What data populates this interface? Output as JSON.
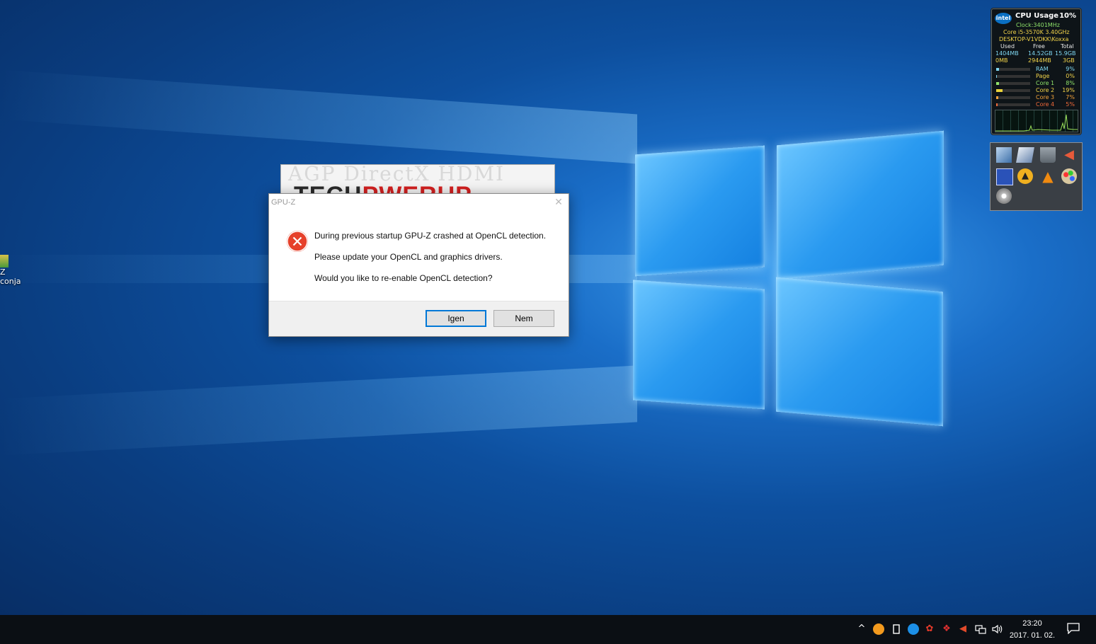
{
  "desktop": {
    "icon_label_1": "Z",
    "icon_label_2": "conja"
  },
  "splash": {
    "bg_text": "AGP   DirectX   HDMI",
    "brand_left": "TECH",
    "brand_mid": "P",
    "brand_right": "WERUP"
  },
  "dialog": {
    "title": "GPU-Z",
    "close_glyph": "✕",
    "message_1": "During previous startup GPU-Z crashed at OpenCL detection.",
    "message_2": "Please update your OpenCL and graphics drivers.",
    "message_3": "Would you like to re-enable OpenCL detection?",
    "yes_label": "Igen",
    "no_label": "Nem"
  },
  "cpu_gadget": {
    "logo": "intel",
    "title": "CPU Usage",
    "usage": "10%",
    "clock": "Clock:3401MHz",
    "cpu_name": "Core i5-3570K 3.40GHz",
    "host": "DESKTOP-V1VDKK\\Koxxa",
    "col_used": "Used",
    "col_free": "Free",
    "col_total": "Total",
    "ram_used": "1404MB",
    "ram_free": "14.52GB",
    "ram_total": "15.9GB",
    "page_used": "0MB",
    "page_free": "2944MB",
    "page_total": "3GB",
    "meters": [
      {
        "label": "RAM",
        "value": "9%",
        "fraction": 0.09
      },
      {
        "label": "Page",
        "value": "0%",
        "fraction": 0.0
      },
      {
        "label": "Core 1",
        "value": "8%",
        "fraction": 0.08
      },
      {
        "label": "Core 2",
        "value": "19%",
        "fraction": 0.19
      },
      {
        "label": "Core 3",
        "value": "7%",
        "fraction": 0.07
      },
      {
        "label": "Core 4",
        "value": "5%",
        "fraction": 0.05
      }
    ]
  },
  "taskbar": {
    "chevron": "^",
    "time": "23:20",
    "date": "2017. 01. 02."
  },
  "colors": {
    "error_red": "#e6402a",
    "accent_blue": "#0078d7"
  }
}
